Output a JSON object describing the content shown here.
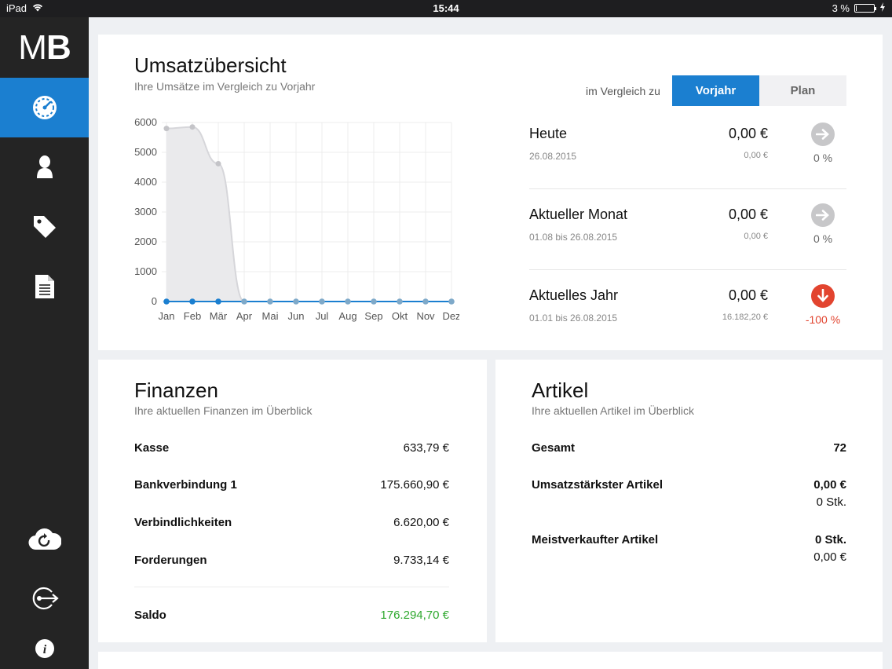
{
  "status_bar": {
    "device": "iPad",
    "time": "15:44",
    "battery_text": "3 %",
    "battery_level": 0.03
  },
  "sidebar": {
    "logo_m": "M",
    "logo_b": "B",
    "items": [
      {
        "icon": "speedometer-icon",
        "active": true
      },
      {
        "icon": "user-icon",
        "active": false
      },
      {
        "icon": "tag-icon",
        "active": false
      },
      {
        "icon": "document-icon",
        "active": false
      },
      {
        "icon": "cloud-sync-icon",
        "active": false
      },
      {
        "icon": "logout-icon",
        "active": false
      },
      {
        "icon": "info-icon",
        "active": false
      }
    ]
  },
  "sales": {
    "title": "Umsatzübersicht",
    "subtitle": "Ihre Umsätze im Vergleich zu Vorjahr",
    "compare_label": "im Vergleich zu",
    "tabs": [
      "Vorjahr",
      "Plan"
    ],
    "active_tab": "Vorjahr",
    "kpis": [
      {
        "label": "Heute",
        "date": "26.08.2015",
        "value": "0,00 €",
        "prev": "0,00 €",
        "pct": "0 %",
        "trend": "neutral"
      },
      {
        "label": "Aktueller Monat",
        "date": "01.08 bis 26.08.2015",
        "value": "0,00 €",
        "prev": "0,00 €",
        "pct": "0 %",
        "trend": "neutral"
      },
      {
        "label": "Aktuelles Jahr",
        "date": "01.01 bis 26.08.2015",
        "value": "0,00 €",
        "prev": "16.182,20 €",
        "pct": "-100 %",
        "trend": "down"
      }
    ]
  },
  "chart_data": {
    "type": "line",
    "categories": [
      "Jan",
      "Feb",
      "Mär",
      "Apr",
      "Mai",
      "Jun",
      "Jul",
      "Aug",
      "Sep",
      "Okt",
      "Nov",
      "Dez"
    ],
    "ylim": [
      0,
      6000
    ],
    "yticks": [
      0,
      1000,
      2000,
      3000,
      4000,
      5000,
      6000
    ],
    "series": [
      {
        "values": [
          0,
          0,
          0,
          0,
          0,
          0,
          0,
          0,
          0,
          0,
          0,
          0
        ],
        "color": "#1b7fd0"
      },
      {
        "values": [
          5800,
          5850,
          4620,
          0,
          0,
          0,
          0,
          0,
          0,
          0,
          0,
          0
        ],
        "color": "#cfcfd3",
        "area": true
      }
    ],
    "grid": true
  },
  "finanzen": {
    "title": "Finanzen",
    "subtitle": "Ihre aktuellen Finanzen im Überblick",
    "rows": [
      {
        "label": "Kasse",
        "value": "633,79 €"
      },
      {
        "label": "Bankverbindung 1",
        "value": "175.660,90 €"
      },
      {
        "label": "Verbindlichkeiten",
        "value": "6.620,00 €"
      },
      {
        "label": "Forderungen",
        "value": "9.733,14 €"
      }
    ],
    "saldo_label": "Saldo",
    "saldo_value": "176.294,70 €"
  },
  "artikel": {
    "title": "Artikel",
    "subtitle": "Ihre aktuellen Artikel im Überblick",
    "gesamt_label": "Gesamt",
    "gesamt_value": "72",
    "top_umsatz_label": "Umsatzstärkster Artikel",
    "top_umsatz_value": "0,00 €",
    "top_umsatz_qty": "0 Stk.",
    "top_verkauf_label": "Meistverkaufter Artikel",
    "top_verkauf_qty": "0 Stk.",
    "top_verkauf_value": "0,00 €"
  }
}
